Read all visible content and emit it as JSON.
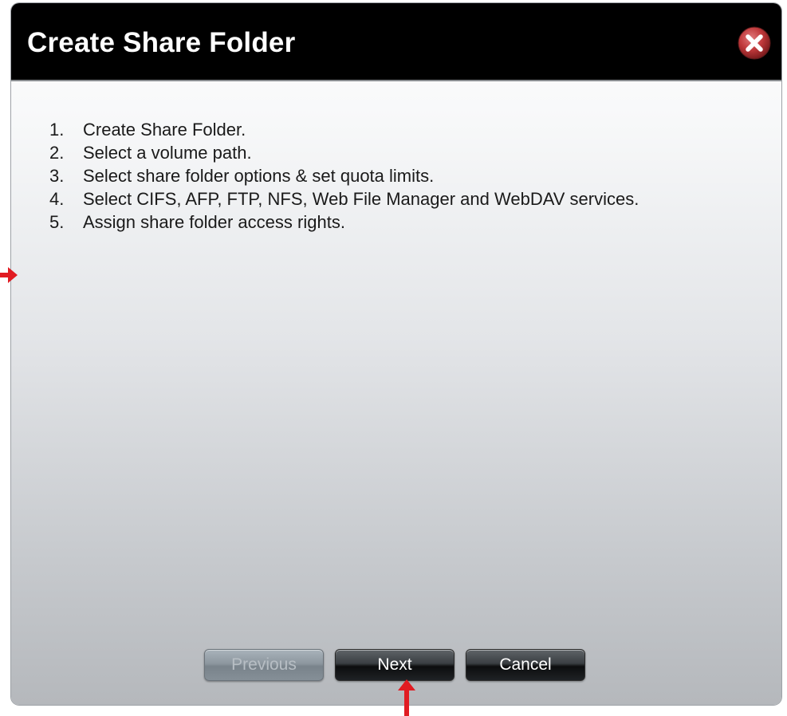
{
  "dialog": {
    "title": "Create Share Folder",
    "close_icon": "close-icon"
  },
  "steps": [
    {
      "num": "1.",
      "text": "Create Share Folder."
    },
    {
      "num": "2.",
      "text": "Select a volume path."
    },
    {
      "num": "3.",
      "text": "Select share folder options & set quota limits."
    },
    {
      "num": "4.",
      "text": "Select CIFS, AFP, FTP, NFS, Web File Manager and WebDAV services."
    },
    {
      "num": "5.",
      "text": "Assign share folder access rights."
    }
  ],
  "buttons": {
    "previous": "Previous",
    "next": "Next",
    "cancel": "Cancel"
  },
  "colors": {
    "title_bar": "#000000",
    "close_icon": "#c0393b",
    "annotation_arrow": "#e11b22"
  }
}
